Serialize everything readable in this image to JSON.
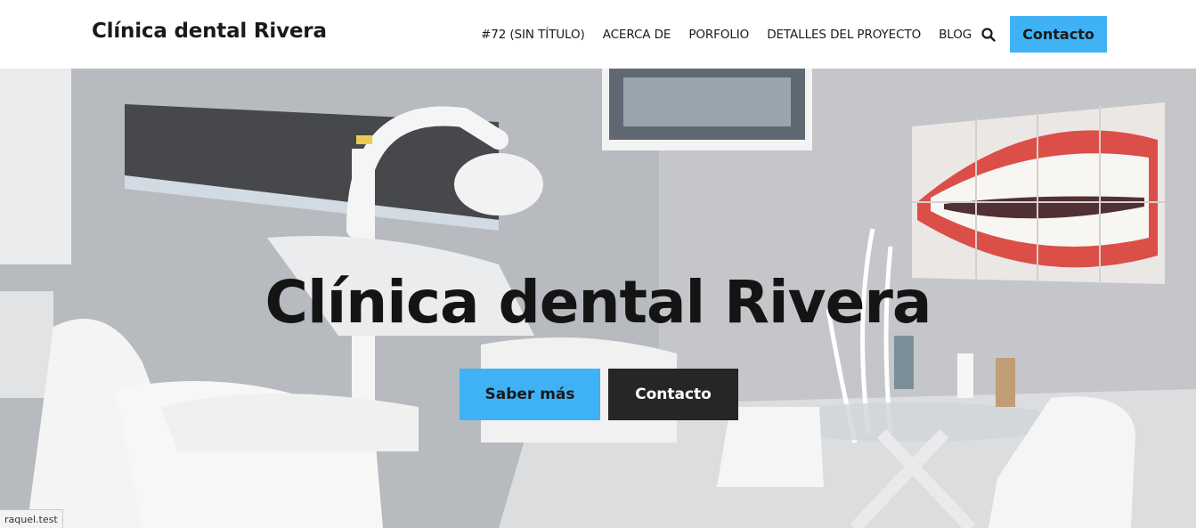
{
  "header": {
    "site_title": "Clínica dental Rivera",
    "nav": [
      {
        "label": "#72 (SIN TÍTULO)"
      },
      {
        "label": "ACERCA DE"
      },
      {
        "label": "PORFOLIO"
      },
      {
        "label": "DETALLES DEL PROYECTO"
      },
      {
        "label": "BLOG"
      }
    ],
    "search_icon": "search-icon",
    "cta_label": "Contacto"
  },
  "hero": {
    "title": "Clínica dental Rivera",
    "primary_button": "Saber más",
    "secondary_button": "Contacto"
  },
  "status_bar": {
    "url": "raquel.test"
  },
  "colors": {
    "accent": "#3fb2f5",
    "dark_button": "#262626",
    "text": "#1a1a1a"
  }
}
